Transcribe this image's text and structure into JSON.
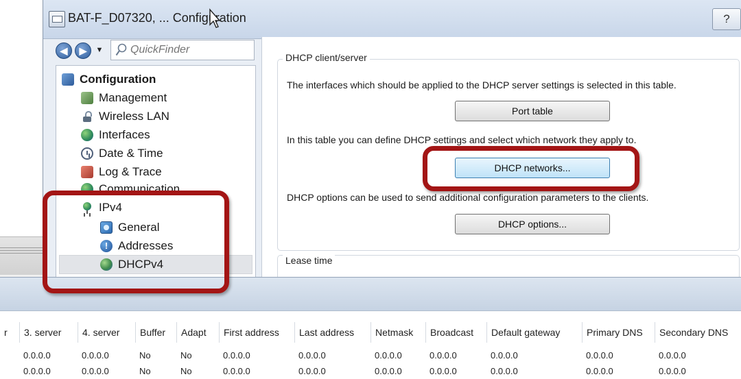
{
  "window": {
    "title": "BAT-F_D07320, ... Configuration",
    "help_label": "?"
  },
  "nav": {
    "quickfinder_placeholder": "QuickFinder",
    "back_glyph": "◀",
    "forward_glyph": "▶",
    "menu_glyph": "▼"
  },
  "tree": {
    "items": [
      {
        "label": "Configuration",
        "icon": "configuration-icon"
      },
      {
        "label": "Management",
        "icon": "management-icon"
      },
      {
        "label": "Wireless LAN",
        "icon": "wireless-lan-icon"
      },
      {
        "label": "Interfaces",
        "icon": "interfaces-icon"
      },
      {
        "label": "Date & Time",
        "icon": "clock-icon"
      },
      {
        "label": "Log & Trace",
        "icon": "log-icon"
      },
      {
        "label": "Communication",
        "icon": "communication-icon"
      },
      {
        "label": "IPv4",
        "icon": "ipv4-icon"
      },
      {
        "label": "General",
        "icon": "general-icon"
      },
      {
        "label": "Addresses",
        "icon": "addresses-icon"
      },
      {
        "label": "DHCPv4",
        "icon": "dhcpv4-icon",
        "selected": true
      }
    ]
  },
  "dhcp_group": {
    "title": "DHCP client/server",
    "desc_port": "The interfaces which should be applied to the DHCP server settings is selected in this table.",
    "port_table_label": "Port table",
    "desc_networks": "In this table you can define DHCP settings and select which network they apply to.",
    "dhcp_networks_label": "DHCP networks...",
    "desc_options": "DHCP options can be used to send additional configuration parameters to the clients.",
    "dhcp_options_label": "DHCP options..."
  },
  "lease_group": {
    "title": "Lease time"
  },
  "table": {
    "columns": [
      "r",
      "3. server",
      "4. server",
      "Buffer",
      "Adapt",
      "First address",
      "Last address",
      "Netmask",
      "Broadcast",
      "Default gateway",
      "Primary DNS",
      "Secondary DNS"
    ],
    "rows": [
      [
        "",
        "0.0.0.0",
        "0.0.0.0",
        "No",
        "No",
        "0.0.0.0",
        "0.0.0.0",
        "0.0.0.0",
        "0.0.0.0",
        "0.0.0.0",
        "0.0.0.0",
        "0.0.0.0"
      ],
      [
        "",
        "0.0.0.0",
        "0.0.0.0",
        "No",
        "No",
        "0.0.0.0",
        "0.0.0.0",
        "0.0.0.0",
        "0.0.0.0",
        "0.0.0.0",
        "0.0.0.0",
        "0.0.0.0"
      ]
    ]
  },
  "colors": {
    "highlight": "#a31515",
    "focus_button": "#bfe3f8"
  }
}
